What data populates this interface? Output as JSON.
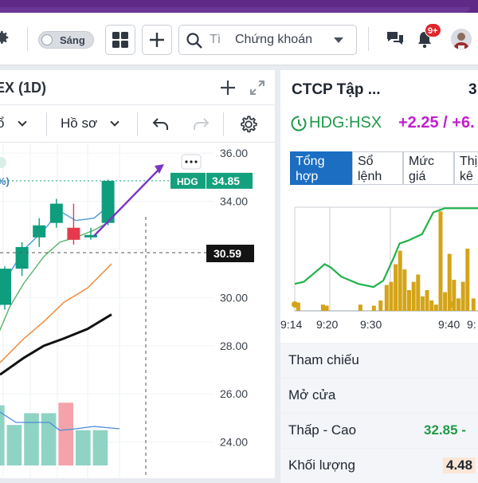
{
  "toolbar": {
    "theme_toggle_label": "Sáng",
    "search_placeholder": "Tì",
    "search_scope": "Chứng khoán",
    "notification_badge": "9+"
  },
  "left_panel": {
    "title": "EX (1D)",
    "dropdown_left": "ổ",
    "profile_dropdown": "Hồ sơ"
  },
  "chart_data": {
    "type": "candlestick",
    "ylim": [
      22.5,
      36.4
    ],
    "y_ticks": [
      "36.00",
      "34.00",
      "32.00",
      "30.00",
      "28.00",
      "26.00",
      "24.00"
    ],
    "last_price_label": "HDG",
    "last_price": "34.85",
    "crosshair_price": "30.59",
    "candles": [
      {
        "open": 29.7,
        "high": 31.3,
        "low": 29.5,
        "close": 31.2,
        "dir": "up"
      },
      {
        "open": 31.2,
        "high": 32.3,
        "low": 30.9,
        "close": 32.1,
        "dir": "up"
      },
      {
        "open": 32.5,
        "high": 33.3,
        "low": 32.1,
        "close": 33.0,
        "dir": "up"
      },
      {
        "open": 33.1,
        "high": 34.1,
        "low": 32.9,
        "close": 33.9,
        "dir": "up"
      },
      {
        "open": 32.9,
        "high": 33.9,
        "low": 32.2,
        "close": 32.4,
        "dir": "down"
      },
      {
        "open": 32.5,
        "high": 32.9,
        "low": 32.4,
        "close": 32.6,
        "dir": "up"
      },
      {
        "open": 33.1,
        "high": 34.9,
        "low": 33.0,
        "close": 34.85,
        "dir": "up"
      }
    ],
    "ma_fast": [
      [
        -2,
        29.5
      ],
      [
        12,
        31.0
      ],
      [
        30,
        32.0
      ],
      [
        55,
        32.8
      ],
      [
        75,
        33.6
      ],
      [
        95,
        33.2
      ],
      [
        118,
        33.3
      ],
      [
        140,
        33.9
      ]
    ],
    "ma_medium": [
      [
        -2,
        28.5
      ],
      [
        12,
        29.6
      ],
      [
        30,
        30.6
      ],
      [
        55,
        31.7
      ],
      [
        75,
        32.3
      ],
      [
        95,
        32.5
      ],
      [
        118,
        32.8
      ],
      [
        140,
        33.2
      ]
    ],
    "ma_orange": [
      [
        0,
        27.3
      ],
      [
        30,
        28.3
      ],
      [
        55,
        29.0
      ],
      [
        80,
        29.8
      ],
      [
        110,
        30.4
      ],
      [
        140,
        31.4
      ]
    ],
    "ma_black": [
      [
        0,
        26.8
      ],
      [
        30,
        27.5
      ],
      [
        55,
        28.0
      ],
      [
        80,
        28.3
      ],
      [
        110,
        28.7
      ],
      [
        140,
        29.3
      ]
    ],
    "volume_bars": [
      {
        "h": 0.92,
        "dir": "up"
      },
      {
        "h": 0.62,
        "dir": "up"
      },
      {
        "h": 0.8,
        "dir": "up"
      },
      {
        "h": 0.8,
        "dir": "up"
      },
      {
        "h": 0.96,
        "dir": "down"
      },
      {
        "h": 0.54,
        "dir": "up"
      },
      {
        "h": 0.54,
        "dir": "up"
      }
    ]
  },
  "right_panel": {
    "company": "CTCP Tập ...",
    "company_cut": "3",
    "ticker": "HDG:HSX",
    "change": "+2.25 / +6.",
    "tabs": [
      "Tổng hợp",
      "Sổ lệnh",
      "Mức giá",
      "Thị kê"
    ],
    "intraday": {
      "x_labels": [
        "9:14",
        "9:20",
        "9:30",
        "9:40",
        "9:"
      ],
      "price_line": [
        [
          0,
          0.74
        ],
        [
          12,
          0.72
        ],
        [
          22,
          0.66
        ],
        [
          40,
          0.55
        ],
        [
          48,
          0.58
        ],
        [
          62,
          0.67
        ],
        [
          85,
          0.74
        ],
        [
          105,
          0.77
        ],
        [
          118,
          0.71
        ],
        [
          132,
          0.49
        ],
        [
          140,
          0.35
        ],
        [
          152,
          0.32
        ],
        [
          170,
          0.26
        ],
        [
          185,
          0.05
        ],
        [
          200,
          0.01
        ],
        [
          248,
          0.01
        ]
      ],
      "volume": [
        {
          "x": 2,
          "h": 0.08
        },
        {
          "x": 35,
          "h": 0.06
        },
        {
          "x": 40,
          "h": 0.05
        },
        {
          "x": 85,
          "h": 0.06
        },
        {
          "x": 103,
          "h": 0.05
        },
        {
          "x": 112,
          "h": 0.1
        },
        {
          "x": 120,
          "h": 0.25
        },
        {
          "x": 126,
          "h": 0.28
        },
        {
          "x": 132,
          "h": 0.45
        },
        {
          "x": 138,
          "h": 0.58
        },
        {
          "x": 144,
          "h": 0.4
        },
        {
          "x": 150,
          "h": 0.2
        },
        {
          "x": 156,
          "h": 0.28
        },
        {
          "x": 162,
          "h": 0.35
        },
        {
          "x": 168,
          "h": 0.14
        },
        {
          "x": 174,
          "h": 0.2
        },
        {
          "x": 180,
          "h": 0.1
        },
        {
          "x": 186,
          "h": 0.06
        },
        {
          "x": 192,
          "h": 0.96
        },
        {
          "x": 198,
          "h": 0.18
        },
        {
          "x": 204,
          "h": 0.55
        },
        {
          "x": 210,
          "h": 0.3
        },
        {
          "x": 216,
          "h": 0.12
        },
        {
          "x": 222,
          "h": 0.28
        },
        {
          "x": 228,
          "h": 0.6
        },
        {
          "x": 236,
          "h": 0.12
        }
      ]
    },
    "info": [
      {
        "label": "Tham chiếu",
        "value": ""
      },
      {
        "label": "Mở cửa",
        "value": ""
      },
      {
        "label": "Thấp - Cao",
        "value": "32.85 -"
      },
      {
        "label": "Khối lượng",
        "value": "4.48"
      }
    ]
  },
  "colors": {
    "up": "#0e9d7d",
    "down": "#e43a4b",
    "accent_purple": "#5e2a86",
    "tab_active": "#1b6ec2",
    "ticker_green": "#1f9a48",
    "change_magenta": "#c21ecf",
    "intraday_bar": "#d4a418"
  }
}
